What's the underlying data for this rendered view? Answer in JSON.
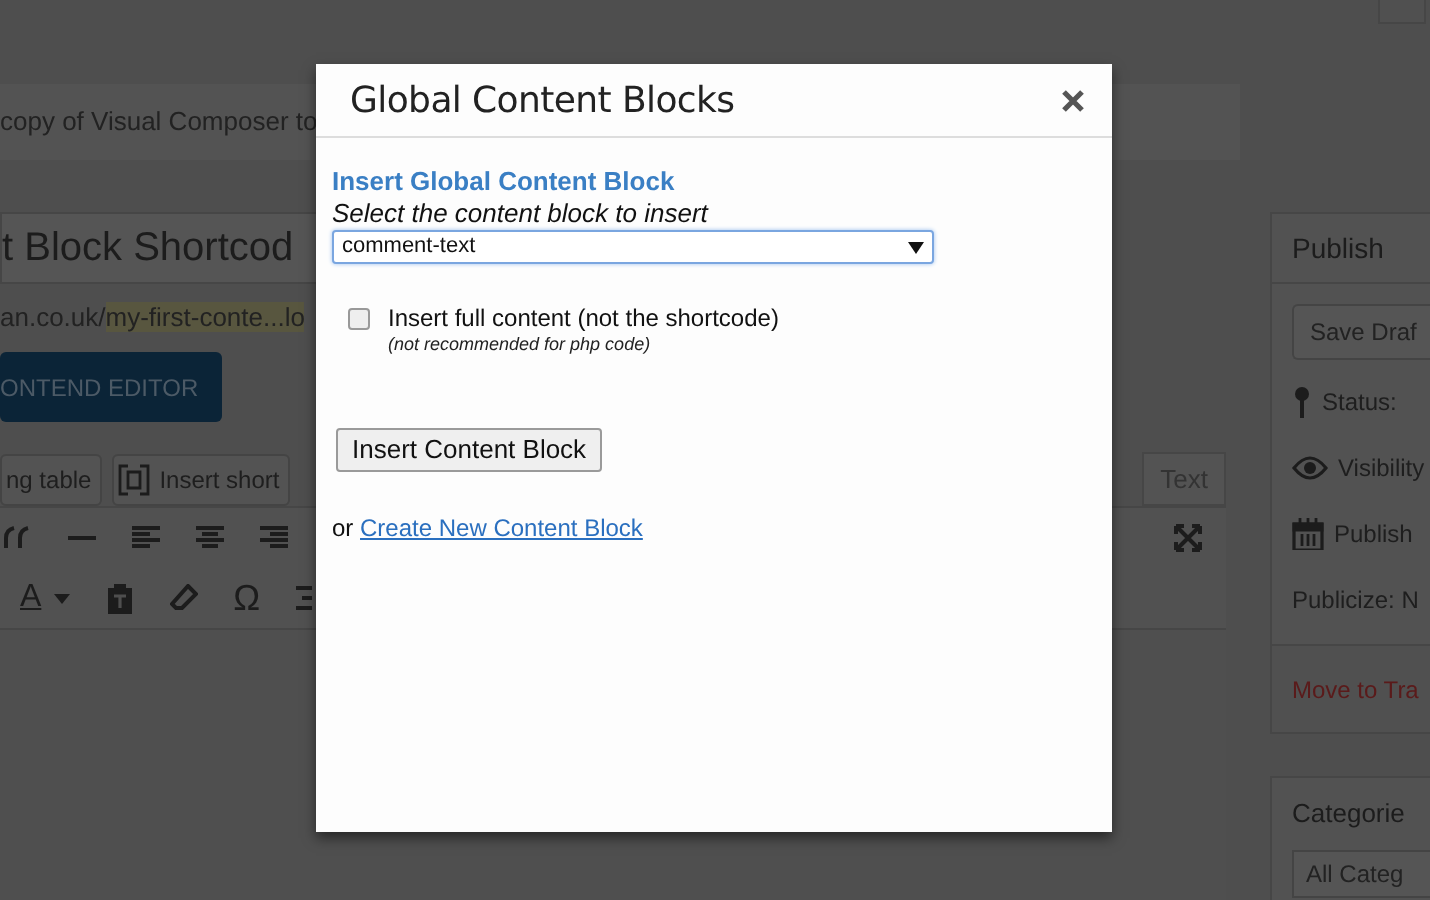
{
  "background": {
    "notice": "copy of Visual Composer to",
    "post_title": "t Block Shortcod",
    "permalink": {
      "base": "an.co.uk/",
      "slug": "my-first-conte...lo"
    },
    "frontend_editor_button": "ONTEND EDITOR",
    "media_buttons": [
      {
        "label": "ng table",
        "kind": "plain"
      },
      {
        "label": "Insert short",
        "kind": "shortcode"
      }
    ],
    "editor_tab": "Text",
    "toolbar_glyphs": {
      "text_color": "A",
      "special_character": "Ω"
    },
    "publish_box": {
      "title": "Publish",
      "save_button": "Save Draf",
      "rows": [
        {
          "kind": "status",
          "label": "Status:"
        },
        {
          "kind": "visibility",
          "label": "Visibility"
        },
        {
          "kind": "schedule",
          "label": "Publish"
        },
        {
          "kind": "plain",
          "label": "Publicize: N"
        }
      ],
      "trash_link": "Move to Tra"
    },
    "categories_box": {
      "title": "Categorie",
      "select": "All Categ"
    }
  },
  "dialog": {
    "title": "Global Content Blocks",
    "heading": "Insert Global Content Block",
    "instruction": "Select the content block to insert",
    "select": {
      "value": "comment-text"
    },
    "full_content": {
      "label": "Insert full content (not the shortcode)",
      "note": "(not recommended for php code)",
      "checked": false
    },
    "insert_button": "Insert Content Block",
    "create_prefix": "or",
    "create_link": "Create New Content Block"
  }
}
